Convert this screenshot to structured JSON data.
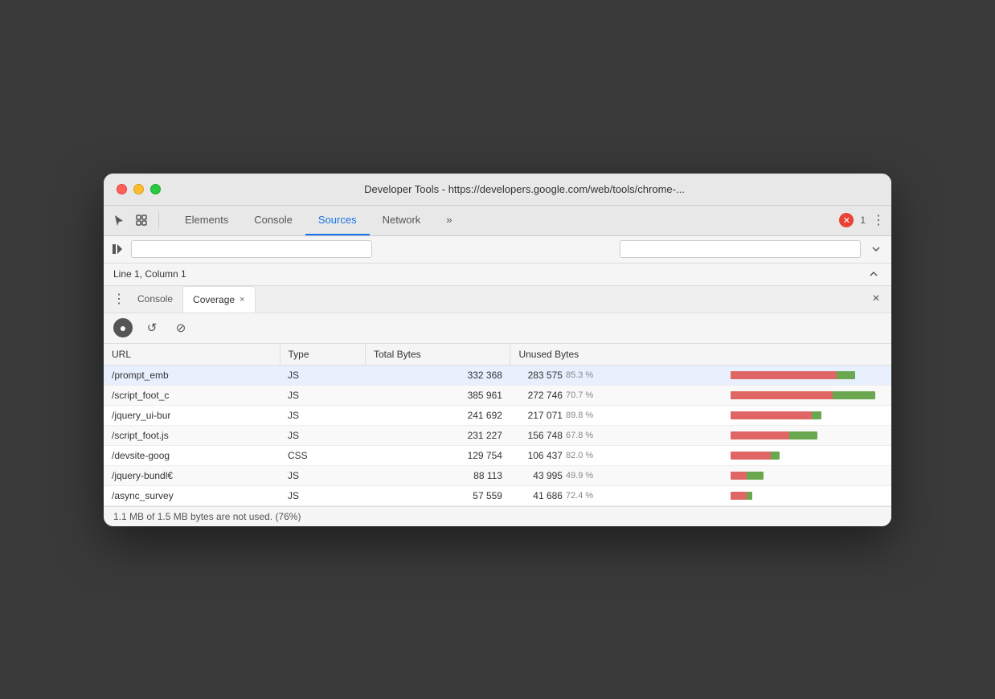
{
  "window": {
    "title": "Developer Tools - https://developers.google.com/web/tools/chrome-..."
  },
  "tabs": {
    "items": [
      {
        "label": "Elements",
        "active": false
      },
      {
        "label": "Console",
        "active": false
      },
      {
        "label": "Sources",
        "active": true
      },
      {
        "label": "Network",
        "active": false
      }
    ],
    "more": "»",
    "error_icon": "✕",
    "error_count": "1",
    "more_menu": "⋮"
  },
  "status": {
    "line_col": "Line 1, Column 1"
  },
  "drawer": {
    "dots": "⋮",
    "tabs": [
      {
        "label": "Console",
        "active": false
      },
      {
        "label": "Coverage",
        "active": true
      }
    ],
    "close": "×"
  },
  "coverage": {
    "toolbar": {
      "record_label": "●",
      "reload_label": "↺",
      "clear_label": "⊘"
    },
    "table": {
      "headers": [
        "URL",
        "Type",
        "Total Bytes",
        "Unused Bytes",
        ""
      ],
      "rows": [
        {
          "url": "/prompt_emb",
          "type": "JS",
          "total": "332 368",
          "unused": "283 575",
          "pct": "85.3 %",
          "red_pct": 85.3,
          "green_pct": 14.7,
          "selected": true
        },
        {
          "url": "/script_foot_c",
          "type": "JS",
          "total": "385 961",
          "unused": "272 746",
          "pct": "70.7 %",
          "red_pct": 70.7,
          "green_pct": 29.3,
          "selected": false
        },
        {
          "url": "/jquery_ui-bur",
          "type": "JS",
          "total": "241 692",
          "unused": "217 071",
          "pct": "89.8 %",
          "red_pct": 89.8,
          "green_pct": 10.2,
          "selected": false
        },
        {
          "url": "/script_foot.js",
          "type": "JS",
          "total": "231 227",
          "unused": "156 748",
          "pct": "67.8 %",
          "red_pct": 67.8,
          "green_pct": 32.2,
          "selected": false
        },
        {
          "url": "/devsite-goog",
          "type": "CSS",
          "total": "129 754",
          "unused": "106 437",
          "pct": "82.0 %",
          "red_pct": 82.0,
          "green_pct": 18.0,
          "selected": false
        },
        {
          "url": "/jquery-bundl€",
          "type": "JS",
          "total": "88 113",
          "unused": "43 995",
          "pct": "49.9 %",
          "red_pct": 49.9,
          "green_pct": 50.1,
          "selected": false
        },
        {
          "url": "/async_survey",
          "type": "JS",
          "total": "57 559",
          "unused": "41 686",
          "pct": "72.4 %",
          "red_pct": 72.4,
          "green_pct": 27.6,
          "selected": false
        }
      ]
    },
    "footer": "1.1 MB of 1.5 MB bytes are not used. (76%)"
  }
}
